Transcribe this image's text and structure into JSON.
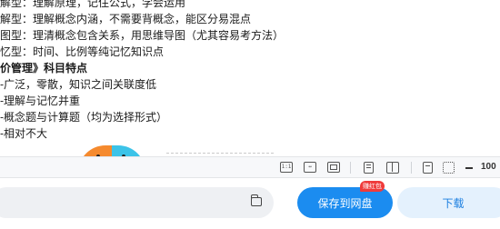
{
  "document": {
    "lines": [
      "解型：理解原理，记住公式，学会运用",
      "解型：理解概念内涵，不需要背概念，能区分易混点",
      "图型：理清概念包含关系，用思维导图（尤其容易考方法）",
      "忆型：时间、比例等纯记忆知识点",
      "价管理》科目特点",
      "-广泛，零散，知识之间关联度低",
      "-理解与记忆并重",
      "-概念题与计算题（均为选择形式）",
      "-相对不大"
    ]
  },
  "toolbar": {
    "icons": [
      "actual-size-icon",
      "fit-width-icon",
      "fit-page-icon",
      "single-page-icon",
      "two-page-icon",
      "rotate-icon",
      "crop-icon"
    ],
    "actual_size_glyph": "1:1",
    "fit_width_glyph": "↔",
    "zoom_value": "100"
  },
  "footer": {
    "save_button_label": "保存到网盘",
    "badge_label": "赚红包",
    "download_button_label": "下载"
  },
  "colors": {
    "save_button": "#1b8cf0",
    "badge": "#ef3b3b",
    "download_button_bg": "#e4f1fd",
    "download_button_text": "#1b7fe0"
  }
}
